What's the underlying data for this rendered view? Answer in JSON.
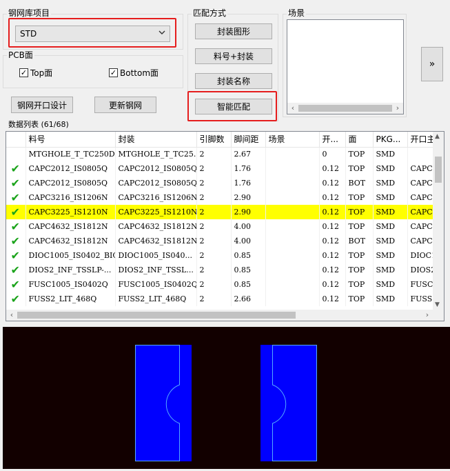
{
  "lib_group": {
    "title": "钢网库项目",
    "selected": "STD"
  },
  "pcb_group": {
    "title": "PCB面",
    "top_label": "Top面",
    "bottom_label": "Bottom面",
    "top_checked": "✓",
    "bottom_checked": "✓"
  },
  "actions": {
    "design_label": "钢网开口设计",
    "update_label": "更新钢网"
  },
  "match_group": {
    "title": "匹配方式",
    "buttons": [
      "封装图形",
      "料号+封装",
      "封装名称",
      "智能匹配"
    ]
  },
  "scene_group": {
    "title": "场景",
    "expand_label": "»"
  },
  "data_list": {
    "title": "数据列表 (61/68)",
    "columns": [
      "",
      "料号",
      "封装",
      "引脚数",
      "脚间距",
      "场景",
      "开...",
      "面",
      "PKG...",
      "开口主"
    ],
    "rows": [
      {
        "check": "",
        "part": "MTGHOLE_T_TC250D...",
        "pkg": "MTGHOLE_T_TC25...",
        "pins": "2",
        "pitch": "2.67",
        "scene": "",
        "open": "0",
        "side": "TOP",
        "pkgtype": "SMD",
        "main": ""
      },
      {
        "check": "✔",
        "part": "CAPC2012_IS0805Q",
        "pkg": "CAPC2012_IS0805Q",
        "pins": "2",
        "pitch": "1.76",
        "scene": "",
        "open": "0.12",
        "side": "TOP",
        "pkgtype": "SMD",
        "main": "CAPC2"
      },
      {
        "check": "✔",
        "part": "CAPC2012_IS0805Q",
        "pkg": "CAPC2012_IS0805Q",
        "pins": "2",
        "pitch": "1.76",
        "scene": "",
        "open": "0.12",
        "side": "BOT",
        "pkgtype": "SMD",
        "main": "CAPC2"
      },
      {
        "check": "✔",
        "part": "CAPC3216_IS1206N",
        "pkg": "CAPC3216_IS1206N",
        "pins": "2",
        "pitch": "2.90",
        "scene": "",
        "open": "0.12",
        "side": "TOP",
        "pkgtype": "SMD",
        "main": "CAPC3"
      },
      {
        "check": "✔",
        "part": "CAPC3225_IS1210N",
        "pkg": "CAPC3225_IS1210N",
        "pins": "2",
        "pitch": "2.90",
        "scene": "",
        "open": "0.12",
        "side": "TOP",
        "pkgtype": "SMD",
        "main": "CAPC3"
      },
      {
        "check": "✔",
        "part": "CAPC4632_IS1812N",
        "pkg": "CAPC4632_IS1812N",
        "pins": "2",
        "pitch": "4.00",
        "scene": "",
        "open": "0.12",
        "side": "TOP",
        "pkgtype": "SMD",
        "main": "CAPC4"
      },
      {
        "check": "✔",
        "part": "CAPC4632_IS1812N",
        "pkg": "CAPC4632_IS1812N",
        "pins": "2",
        "pitch": "4.00",
        "scene": "",
        "open": "0.12",
        "side": "BOT",
        "pkgtype": "SMD",
        "main": "CAPC4"
      },
      {
        "check": "✔",
        "part": "DIOC1005_IS0402_BIQ",
        "pkg": "DIOC1005_IS040...",
        "pins": "2",
        "pitch": "0.85",
        "scene": "",
        "open": "0.12",
        "side": "TOP",
        "pkgtype": "SMD",
        "main": "DIOC1"
      },
      {
        "check": "✔",
        "part": "DIOS2_INF_TSSLP-...",
        "pkg": "DIOS2_INF_TSSL...",
        "pins": "2",
        "pitch": "0.85",
        "scene": "",
        "open": "0.12",
        "side": "TOP",
        "pkgtype": "SMD",
        "main": "DIOS2"
      },
      {
        "check": "✔",
        "part": "FUSC1005_IS0402Q",
        "pkg": "FUSC1005_IS0402Q",
        "pins": "2",
        "pitch": "0.85",
        "scene": "",
        "open": "0.12",
        "side": "TOP",
        "pkgtype": "SMD",
        "main": "FUSC1"
      },
      {
        "check": "✔",
        "part": "FUSS2_LIT_468Q",
        "pkg": "FUSS2_LIT_468Q",
        "pins": "2",
        "pitch": "2.66",
        "scene": "",
        "open": "0.12",
        "side": "TOP",
        "pkgtype": "SMD",
        "main": "FUSS2"
      }
    ],
    "selected_row": 4
  },
  "colors": {
    "highlight": "#ffff00",
    "check": "#1aa31a",
    "red_box": "#e51c1c",
    "pad_fill": "#0000ff",
    "pad_outline": "#55aaff",
    "preview_bg": "#120000"
  }
}
